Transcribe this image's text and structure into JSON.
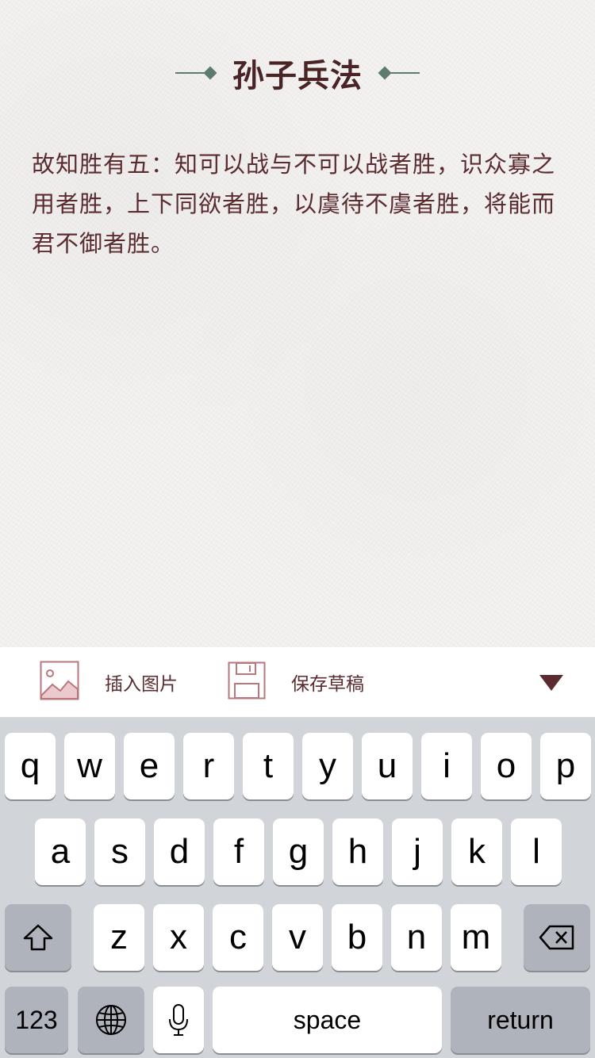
{
  "header": {
    "title": "孙子兵法"
  },
  "content": {
    "text": "故知胜有五：知可以战与不可以战者胜，识众寡之用者胜，上下同欲者胜，以虞待不虞者胜，将能而君不御者胜。"
  },
  "toolbar": {
    "insert_image_label": "插入图片",
    "save_draft_label": "保存草稿",
    "insert_icon": "image-icon",
    "save_icon": "floppy-disk-icon",
    "collapse_icon": "collapse-triangle-icon"
  },
  "keyboard": {
    "row1": [
      "q",
      "w",
      "e",
      "r",
      "t",
      "y",
      "u",
      "i",
      "o",
      "p"
    ],
    "row2": [
      "a",
      "s",
      "d",
      "f",
      "g",
      "h",
      "j",
      "k",
      "l"
    ],
    "row3": [
      "z",
      "x",
      "c",
      "v",
      "b",
      "n",
      "m"
    ],
    "shift_icon": "shift-icon",
    "delete_icon": "backspace-icon",
    "numbers_label": "123",
    "globe_icon": "globe-icon",
    "mic_icon": "microphone-icon",
    "space_label": "space",
    "return_label": "return"
  },
  "colors": {
    "accent_green": "#5e7c6e",
    "text_maroon": "#5a2b2f",
    "keyboard_bg": "#d1d4d9"
  }
}
